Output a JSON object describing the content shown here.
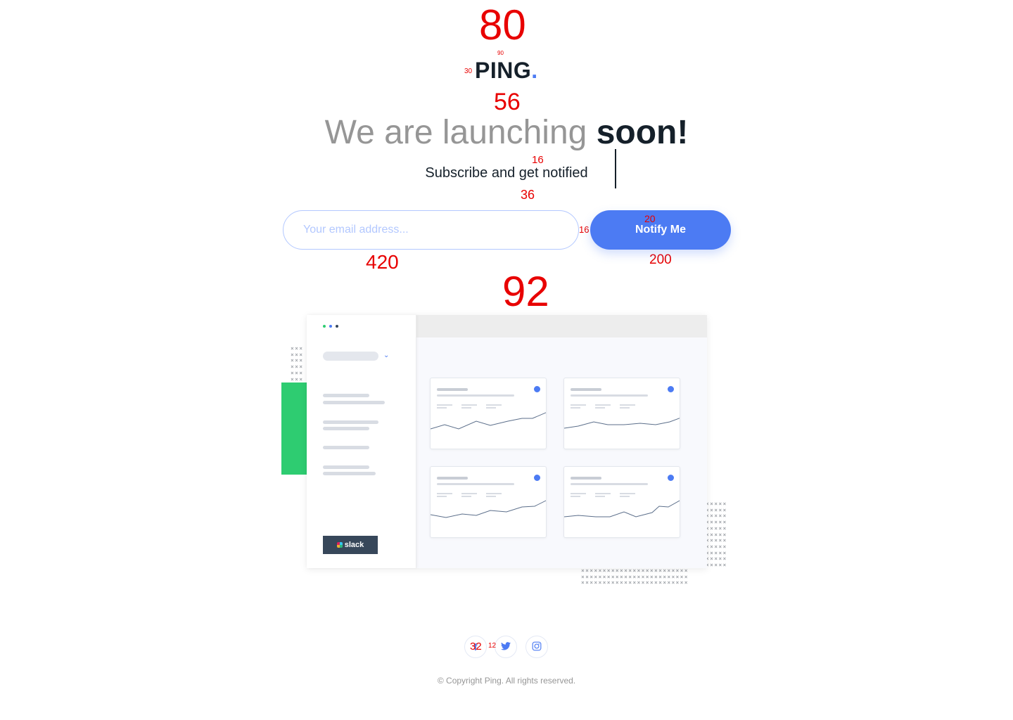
{
  "annotations": {
    "logo_top": "80",
    "logo_height": "90",
    "logo_small": "30",
    "headline_gap": "56",
    "sub_gap": "16",
    "form_gap": "36",
    "input_pad": "28",
    "form_spacing": "16",
    "btn_font": "20",
    "input_width": "420",
    "btn_width": "200",
    "illustration_gap": "92",
    "icon_size": "32",
    "icon_gap": "12"
  },
  "brand": {
    "name": "PING",
    "dot": ".",
    "accent_color": "#4C7BF3"
  },
  "headline": {
    "light": "We are launching ",
    "bold": "soon!"
  },
  "subtitle": "Subscribe and get notified",
  "form": {
    "email_placeholder": "Your email address...",
    "button_label": "Notify Me"
  },
  "dashboard": {
    "slack_label": "slack",
    "chevron": "⌄",
    "window_dots": [
      "#2ECC71",
      "#4C7BF3",
      "#37475A"
    ]
  },
  "social": [
    {
      "name": "facebook-icon",
      "glyph": "f"
    },
    {
      "name": "twitter-icon",
      "glyph": "🐦"
    },
    {
      "name": "instagram-icon",
      "glyph": "◎"
    }
  ],
  "footer": {
    "copyright": "© Copyright Ping. All rights reserved."
  },
  "colors": {
    "primary": "#4C7BF3",
    "green": "#2ECC71",
    "dark": "#15202A",
    "gray": "#969696",
    "input_border": "#B3C8FF"
  }
}
